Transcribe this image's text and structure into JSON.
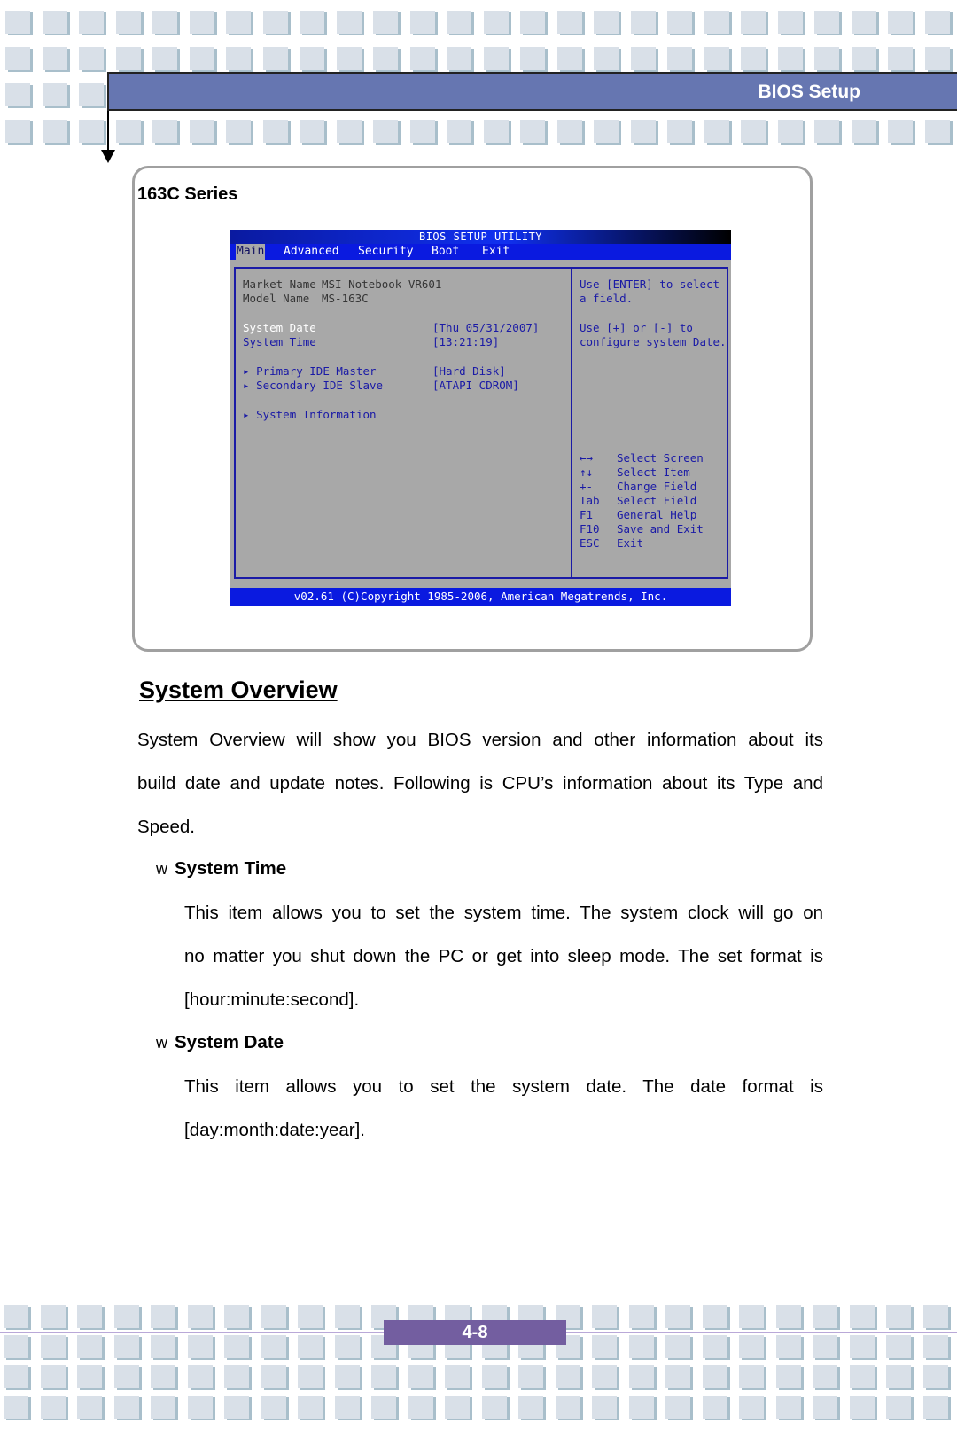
{
  "header": {
    "title": "BIOS Setup"
  },
  "figure": {
    "series_label": "163C Series",
    "bios": {
      "title": "BIOS SETUP UTILITY",
      "menu": [
        "Main",
        "Advanced",
        "Security",
        "Boot",
        "Exit"
      ],
      "active_menu": "Main",
      "info": [
        {
          "label": "Market Name",
          "value": "MSI Notebook VR601"
        },
        {
          "label": "Model Name",
          "value": "MS-163C"
        }
      ],
      "settings": [
        {
          "label": "System Date",
          "value": "[Thu 05/31/2007]",
          "selected": true
        },
        {
          "label": "System Time",
          "value": "[13:21:19]"
        }
      ],
      "submenus": [
        {
          "label": "Primary IDE Master",
          "value": "[Hard Disk]"
        },
        {
          "label": "Secondary IDE Slave",
          "value": "[ATAPI CDROM]"
        },
        {
          "label": "System Information",
          "value": ""
        }
      ],
      "help": [
        "Use [ENTER] to select",
        "a field.",
        "",
        "Use [+] or [-] to",
        "configure system Date."
      ],
      "keys": [
        {
          "key": "←→",
          "action": "Select Screen"
        },
        {
          "key": "↑↓",
          "action": "Select Item"
        },
        {
          "key": "+-",
          "action": "Change Field"
        },
        {
          "key": "Tab",
          "action": "Select Field"
        },
        {
          "key": "F1",
          "action": "General Help"
        },
        {
          "key": "F10",
          "action": "Save and Exit"
        },
        {
          "key": "ESC",
          "action": "Exit"
        }
      ],
      "footer": "v02.61 (C)Copyright 1985-2006, American Megatrends, Inc."
    }
  },
  "content": {
    "section_title": "System Overview",
    "intro_lines": [
      "System Overview will show you BIOS version and other information about its",
      "build date and update notes. Following is CPU’s information about its Type and",
      "Speed."
    ],
    "bullet_marker": "w",
    "items": [
      {
        "title": "System Time",
        "lines": [
          "This item allows you to set the system time.   The system clock will go on",
          "no matter you shut down the PC or get into sleep mode.   The set format is",
          "[hour:minute:second]."
        ]
      },
      {
        "title": "System Date",
        "lines": [
          "This item allows you to set the system date.   The date format is",
          "[day:month:date:year]."
        ]
      }
    ]
  },
  "footer": {
    "page_number": "4-8"
  }
}
